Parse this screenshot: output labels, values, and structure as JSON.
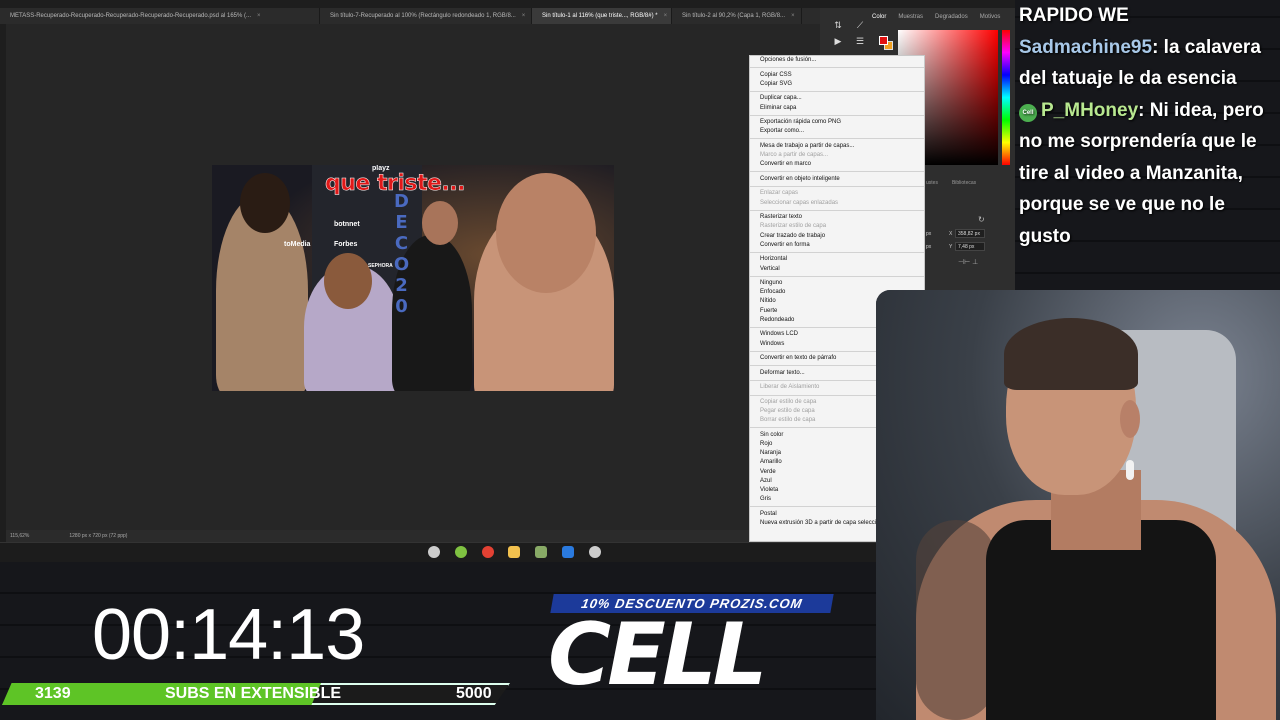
{
  "photoshop": {
    "tabs": [
      {
        "label": "METASS-Recuperado-Recuperado-Recuperado-Recuperado-Recuperado.psd al 165% (...",
        "active": false
      },
      {
        "label": "Sin título-7-Recuperado al 100% (Rectángulo redondeado 1, RGB/8...",
        "active": false
      },
      {
        "label": "Sin título-1 al 116% (que triste..., RGB/8#) *",
        "active": true
      },
      {
        "label": "Sin título-2 al 90,2% (Capa 1, RGB/8...",
        "active": false
      }
    ],
    "tab_close": "×",
    "status_zoom": "115,62%",
    "status_doc": "1280 px x 720 px (72 ppp)",
    "panel_tabs": [
      "Color",
      "Muestras",
      "Degradados",
      "Motivos"
    ],
    "props_tabs": [
      "ustes",
      "Bibliotecas"
    ],
    "prop_x": "X",
    "prop_y": "Y",
    "prop_x_val": "358,82 px",
    "prop_y_val": "7,48 px",
    "prop_left": "px"
  },
  "thumbnail": {
    "title": "que triste...",
    "logos": [
      "playz",
      "botnnet",
      "Forbes",
      "toMedia",
      "SEPHORA"
    ],
    "vertical_text": "DECO20"
  },
  "context_menu": {
    "groups": [
      [
        {
          "label": "Opciones de fusión...",
          "disabled": false
        }
      ],
      [
        {
          "label": "Copiar CSS",
          "disabled": false
        },
        {
          "label": "Copiar SVG",
          "disabled": false
        }
      ],
      [
        {
          "label": "Duplicar capa...",
          "disabled": false
        },
        {
          "label": "Eliminar capa",
          "disabled": false
        }
      ],
      [
        {
          "label": "Exportación rápida como PNG",
          "disabled": false
        },
        {
          "label": "Exportar como...",
          "disabled": false
        }
      ],
      [
        {
          "label": "Mesa de trabajo a partir de capas...",
          "disabled": false
        },
        {
          "label": "Marco a partir de capas...",
          "disabled": true
        },
        {
          "label": "Convertir en marco",
          "disabled": false
        }
      ],
      [
        {
          "label": "Convertir en objeto inteligente",
          "disabled": false
        }
      ],
      [
        {
          "label": "Enlazar capas",
          "disabled": true
        },
        {
          "label": "Seleccionar capas enlazadas",
          "disabled": true
        }
      ],
      [
        {
          "label": "Rasterizar texto",
          "disabled": false
        },
        {
          "label": "Rasterizar estilo de capa",
          "disabled": true
        },
        {
          "label": "Crear trazado de trabajo",
          "disabled": false
        },
        {
          "label": "Convertir en forma",
          "disabled": false
        }
      ],
      [
        {
          "label": "Horizontal",
          "disabled": false
        },
        {
          "label": "Vertical",
          "disabled": false
        }
      ],
      [
        {
          "label": "Ninguno",
          "disabled": false
        },
        {
          "label": "Enfocado",
          "disabled": false
        },
        {
          "label": "Nítido",
          "disabled": false
        },
        {
          "label": "Fuerte",
          "disabled": false
        },
        {
          "label": "Redondeado",
          "disabled": false
        }
      ],
      [
        {
          "label": "Windows LCD",
          "disabled": false
        },
        {
          "label": "Windows",
          "disabled": false
        }
      ],
      [
        {
          "label": "Convertir en texto de párrafo",
          "disabled": false
        }
      ],
      [
        {
          "label": "Deformar texto...",
          "disabled": false
        }
      ],
      [
        {
          "label": "Liberar de Aislamiento",
          "disabled": true
        }
      ],
      [
        {
          "label": "Copiar estilo de capa",
          "disabled": true
        },
        {
          "label": "Pegar estilo de capa",
          "disabled": true
        },
        {
          "label": "Borrar estilo de capa",
          "disabled": true
        }
      ],
      [
        {
          "label": "Sin color",
          "disabled": false
        },
        {
          "label": "Rojo",
          "disabled": false
        },
        {
          "label": "Naranja",
          "disabled": false
        },
        {
          "label": "Amarillo",
          "disabled": false
        },
        {
          "label": "Verde",
          "disabled": false
        },
        {
          "label": "Azul",
          "disabled": false
        },
        {
          "label": "Violeta",
          "disabled": false
        },
        {
          "label": "Gris",
          "disabled": false
        }
      ],
      [
        {
          "label": "Postal",
          "disabled": false
        },
        {
          "label": "Nueva extrusión 3D a partir de capa seleccionada",
          "disabled": false
        }
      ]
    ]
  },
  "taskbar": {
    "icons": [
      {
        "name": "clock-icon",
        "color": "#cccccc"
      },
      {
        "name": "whatsapp-icon",
        "color": "#7fc241"
      },
      {
        "name": "chrome-icon",
        "color": "#e34133"
      },
      {
        "name": "folder-icon",
        "color": "#f2c14e"
      },
      {
        "name": "app-icon",
        "color": "#88aa66"
      },
      {
        "name": "photoshop-icon",
        "color": "#2a7adf"
      },
      {
        "name": "browser-icon",
        "color": "#cccccc"
      }
    ]
  },
  "chat": {
    "messages": [
      {
        "user": "",
        "text": "RAPIDO WE"
      },
      {
        "user": "Sadmachine95",
        "text": ": la calavera del tatuaje le da esencia"
      },
      {
        "user": "P_MHoney",
        "text": ": Ni idea, pero no me sorprendería que le tire al video a Manzanita, porque se ve que no le gusto"
      }
    ],
    "badge": "Cell"
  },
  "overlay": {
    "timer": "00:14:13",
    "goal_current": "3139",
    "goal_label": "SUBS EN EXTENSIBLE",
    "goal_max": "5000",
    "goal_progress": 0.628,
    "promo": "10% DESCUENTO PROZIS.COM",
    "sponsor": "CELL"
  },
  "colors": {
    "accent_green": "#5ec426",
    "title_red": "#e01818",
    "promo_blue": "#1c3a9a",
    "fg_color": "#e01010",
    "bg_color": "#f0a020"
  }
}
